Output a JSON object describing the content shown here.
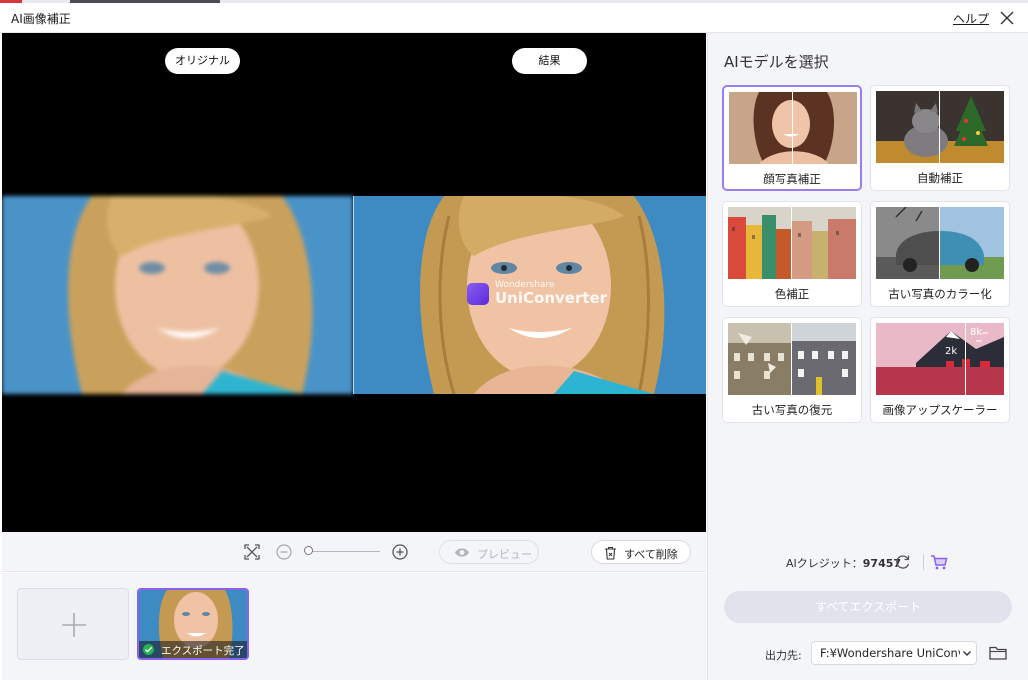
{
  "window": {
    "title": "AI画像補正",
    "help_label": "ヘルプ"
  },
  "preview": {
    "original_label": "オリジナル",
    "result_label": "結果",
    "watermark": {
      "line1": "Wondershare",
      "line2": "UniConverter"
    }
  },
  "toolbar": {
    "preview_label": "プレビュー",
    "delete_all_label": "すべて削除",
    "zoom_level": 0
  },
  "files": [
    {
      "status": "エクスポート完了"
    }
  ],
  "panel": {
    "heading": "AIモデルを選択",
    "models": [
      {
        "label": "顔写真補正",
        "selected": true
      },
      {
        "label": "自動補正",
        "selected": false
      },
      {
        "label": "色補正",
        "selected": false
      },
      {
        "label": "古い写真のカラー化",
        "selected": false
      },
      {
        "label": "古い写真の復元",
        "selected": false
      },
      {
        "label": "画像アップスケーラー",
        "selected": false,
        "badges": [
          "8k",
          "2k"
        ]
      }
    ],
    "credits_label": "AIクレジット：",
    "credits_value": "97457",
    "export_all_label": "すべてエクスポート",
    "output_label": "出力先:",
    "output_path": "F:¥Wondershare UniConv"
  },
  "colors": {
    "accent": "#8c5ff3",
    "bg": "#f4f5f9",
    "photo_bg": "#3e8bc3"
  }
}
